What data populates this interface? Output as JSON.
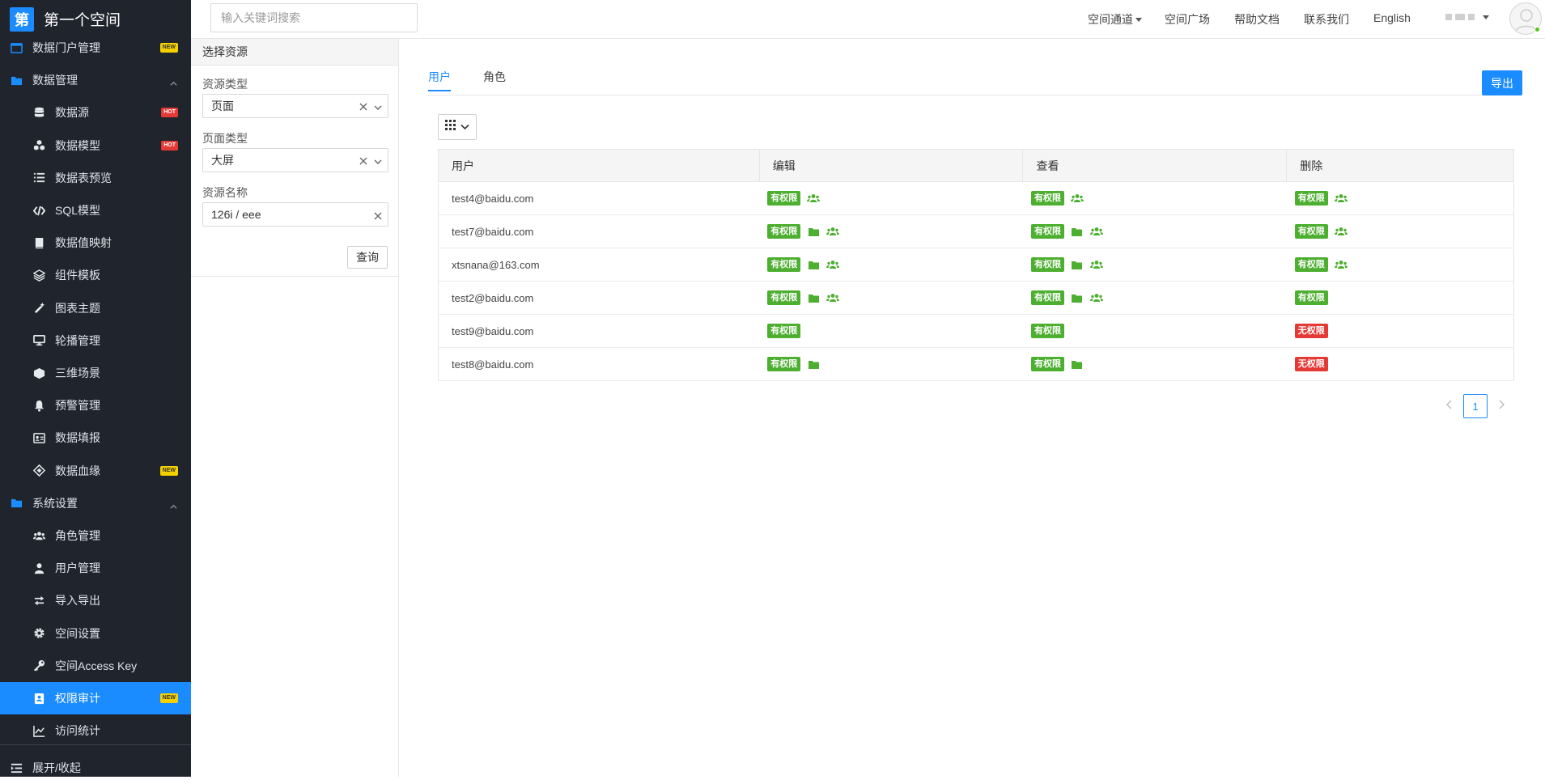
{
  "brand": {
    "logo_char": "第",
    "name": "第一个空间"
  },
  "search": {
    "placeholder": "输入关键词搜索"
  },
  "top_nav": {
    "channel": "空间通道",
    "plaza": "空间广场",
    "help": "帮助文档",
    "contact": "联系我们",
    "language": "English"
  },
  "sidebar": {
    "items": [
      {
        "label": "数据门户管理",
        "icon": "portal-icon",
        "badge": "NEW",
        "level": "top",
        "chevron": false
      },
      {
        "label": "数据管理",
        "icon": "folder-icon",
        "badge": "",
        "level": "top",
        "chevron": true
      },
      {
        "label": "数据源",
        "icon": "database-icon",
        "badge": "HOT",
        "level": "sub"
      },
      {
        "label": "数据模型",
        "icon": "cubes-icon",
        "badge": "HOT",
        "level": "sub"
      },
      {
        "label": "数据表预览",
        "icon": "list-icon",
        "badge": "",
        "level": "sub"
      },
      {
        "label": "SQL模型",
        "icon": "code-icon",
        "badge": "",
        "level": "sub"
      },
      {
        "label": "数据值映射",
        "icon": "book-icon",
        "badge": "",
        "level": "sub"
      },
      {
        "label": "组件模板",
        "icon": "layers-icon",
        "badge": "",
        "level": "sub"
      },
      {
        "label": "图表主题",
        "icon": "magic-wand-icon",
        "badge": "",
        "level": "sub"
      },
      {
        "label": "轮播管理",
        "icon": "monitor-icon",
        "badge": "",
        "level": "sub"
      },
      {
        "label": "三维场景",
        "icon": "cube-icon",
        "badge": "",
        "level": "sub"
      },
      {
        "label": "预警管理",
        "icon": "bell-icon",
        "badge": "",
        "level": "sub"
      },
      {
        "label": "数据填报",
        "icon": "id-card-icon",
        "badge": "",
        "level": "sub"
      },
      {
        "label": "数据血缘",
        "icon": "lineage-icon",
        "badge": "NEW",
        "level": "sub"
      },
      {
        "label": "系统设置",
        "icon": "folder-icon",
        "badge": "",
        "level": "top",
        "chevron": true
      },
      {
        "label": "角色管理",
        "icon": "users-icon",
        "badge": "",
        "level": "sub"
      },
      {
        "label": "用户管理",
        "icon": "user-icon",
        "badge": "",
        "level": "sub"
      },
      {
        "label": "导入导出",
        "icon": "exchange-icon",
        "badge": "",
        "level": "sub"
      },
      {
        "label": "空间设置",
        "icon": "gear-icon",
        "badge": "",
        "level": "sub"
      },
      {
        "label": "空间Access Key",
        "icon": "key-icon",
        "badge": "",
        "level": "sub"
      },
      {
        "label": "权限审计",
        "icon": "audit-icon",
        "badge": "NEW",
        "level": "sub",
        "active": true
      },
      {
        "label": "访问统计",
        "icon": "line-chart-icon",
        "badge": "",
        "level": "sub"
      }
    ],
    "collapse_label": "展开/收起"
  },
  "filter": {
    "header": "选择资源",
    "resource_type_label": "资源类型",
    "resource_type_value": "页面",
    "page_type_label": "页面类型",
    "page_type_value": "大屏",
    "resource_name_label": "资源名称",
    "resource_name_value": "126i / eee",
    "query_button": "查询"
  },
  "main": {
    "tabs": [
      "用户",
      "角色"
    ],
    "active_tab": "用户",
    "export_button": "导出"
  },
  "table": {
    "columns": [
      "用户",
      "编辑",
      "查看",
      "删除"
    ],
    "rows": [
      {
        "user": "test4@baidu.com",
        "edit": {
          "status": "有权限",
          "folder": false,
          "group": true
        },
        "view": {
          "status": "有权限",
          "folder": false,
          "group": true
        },
        "delete": {
          "status": "有权限",
          "folder": false,
          "group": true
        }
      },
      {
        "user": "test7@baidu.com",
        "edit": {
          "status": "有权限",
          "folder": true,
          "group": true
        },
        "view": {
          "status": "有权限",
          "folder": true,
          "group": true
        },
        "delete": {
          "status": "有权限",
          "folder": false,
          "group": true
        }
      },
      {
        "user": "xtsnana@163.com",
        "edit": {
          "status": "有权限",
          "folder": true,
          "group": true
        },
        "view": {
          "status": "有权限",
          "folder": true,
          "group": true
        },
        "delete": {
          "status": "有权限",
          "folder": false,
          "group": true
        }
      },
      {
        "user": "test2@baidu.com",
        "edit": {
          "status": "有权限",
          "folder": true,
          "group": true
        },
        "view": {
          "status": "有权限",
          "folder": true,
          "group": true
        },
        "delete": {
          "status": "有权限",
          "folder": false,
          "group": false
        }
      },
      {
        "user": "test9@baidu.com",
        "edit": {
          "status": "有权限",
          "folder": false,
          "group": false
        },
        "view": {
          "status": "有权限",
          "folder": false,
          "group": false
        },
        "delete": {
          "status": "无权限",
          "folder": false,
          "group": false
        }
      },
      {
        "user": "test8@baidu.com",
        "edit": {
          "status": "有权限",
          "folder": true,
          "group": false
        },
        "view": {
          "status": "有权限",
          "folder": true,
          "group": false
        },
        "delete": {
          "status": "无权限",
          "folder": false,
          "group": false
        }
      }
    ]
  },
  "pagination": {
    "current_page": "1"
  },
  "colors": {
    "accent": "#1a8cff",
    "granted": "#4caf2f",
    "denied": "#e53935",
    "sidebar_bg": "#20242d"
  }
}
